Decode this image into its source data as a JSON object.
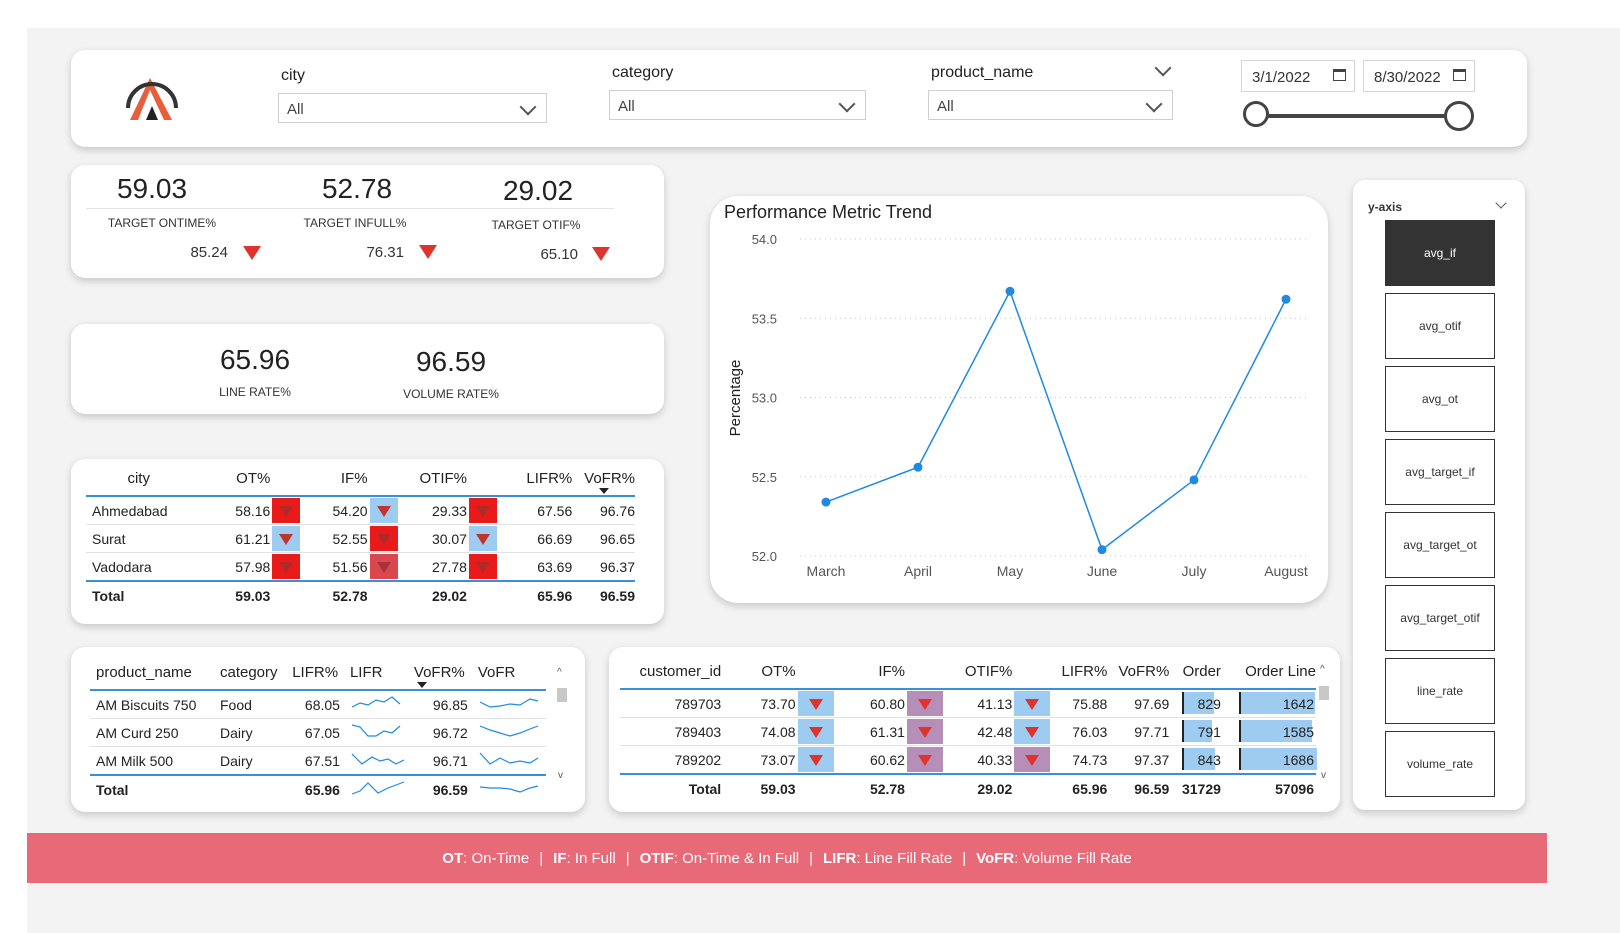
{
  "filters": {
    "city": {
      "label": "city",
      "value": "All"
    },
    "category": {
      "label": "category",
      "value": "All"
    },
    "product_name": {
      "label": "product_name",
      "value": "All"
    },
    "date_start": "3/1/2022",
    "date_end": "8/30/2022"
  },
  "kpis_top": [
    {
      "value": "59.03",
      "label": "TARGET ONTIME%",
      "target": "85.24"
    },
    {
      "value": "52.78",
      "label": "TARGET INFULL%",
      "target": "76.31"
    },
    {
      "value": "29.02",
      "label": "TARGET OTIF%",
      "target": "65.10"
    }
  ],
  "kpis_rates": [
    {
      "value": "65.96",
      "label": "LINE RATE%"
    },
    {
      "value": "96.59",
      "label": "VOLUME RATE%"
    }
  ],
  "city_table": {
    "headers": [
      "city",
      "OT%",
      "IF%",
      "OTIF%",
      "LIFR%",
      "VoFR%"
    ],
    "rows": [
      {
        "city": "Ahmedabad",
        "ot": "58.16",
        "if": "54.20",
        "otif": "29.33",
        "lifr": "67.56",
        "vofr": "96.76"
      },
      {
        "city": "Surat",
        "ot": "61.21",
        "if": "52.55",
        "otif": "30.07",
        "lifr": "66.69",
        "vofr": "96.65"
      },
      {
        "city": "Vadodara",
        "ot": "57.98",
        "if": "51.56",
        "otif": "27.78",
        "lifr": "63.69",
        "vofr": "96.37"
      }
    ],
    "total": {
      "label": "Total",
      "ot": "59.03",
      "if": "52.78",
      "otif": "29.02",
      "lifr": "65.96",
      "vofr": "96.59"
    }
  },
  "product_table": {
    "headers": [
      "product_name",
      "category",
      "LIFR%",
      "LIFR",
      "VoFR%",
      "VoFR"
    ],
    "rows": [
      {
        "name": "AM Biscuits 750",
        "category": "Food",
        "lifr": "68.05",
        "vofr": "96.85"
      },
      {
        "name": "AM Curd 250",
        "category": "Dairy",
        "lifr": "67.05",
        "vofr": "96.72"
      },
      {
        "name": "AM Milk 500",
        "category": "Dairy",
        "lifr": "67.51",
        "vofr": "96.71"
      }
    ],
    "total": {
      "label": "Total",
      "lifr": "65.96",
      "vofr": "96.59"
    }
  },
  "customer_table": {
    "headers": [
      "customer_id",
      "OT%",
      "IF%",
      "OTIF%",
      "LIFR%",
      "VoFR%",
      "Order",
      "Order Line"
    ],
    "rows": [
      {
        "id": "789703",
        "ot": "73.70",
        "if": "60.80",
        "otif": "41.13",
        "lifr": "75.88",
        "vofr": "97.69",
        "order": "829",
        "order_line": "1642"
      },
      {
        "id": "789403",
        "ot": "74.08",
        "if": "61.31",
        "otif": "42.48",
        "lifr": "76.03",
        "vofr": "97.71",
        "order": "791",
        "order_line": "1585"
      },
      {
        "id": "789202",
        "ot": "73.07",
        "if": "60.62",
        "otif": "40.33",
        "lifr": "74.73",
        "vofr": "97.37",
        "order": "843",
        "order_line": "1686"
      }
    ],
    "total": {
      "label": "Total",
      "ot": "59.03",
      "if": "52.78",
      "otif": "29.02",
      "lifr": "65.96",
      "vofr": "96.59",
      "order": "31729",
      "order_line": "57096"
    }
  },
  "chart_data": {
    "type": "line",
    "title": "Performance Metric Trend",
    "xlabel": "",
    "ylabel": "Percentage",
    "categories": [
      "March",
      "April",
      "May",
      "June",
      "July",
      "August"
    ],
    "series": [
      {
        "values": [
          52.34,
          52.56,
          53.67,
          52.04,
          52.48,
          53.62
        ]
      }
    ],
    "ylim": [
      52.0,
      54.0
    ],
    "yticks": [
      "52.0",
      "52.5",
      "53.0",
      "53.5",
      "54.0"
    ],
    "grid": true,
    "color": "#1f8ae0"
  },
  "yaxis_selector": {
    "label": "y-axis",
    "options": [
      "avg_if",
      "avg_otif",
      "avg_ot",
      "avg_target_if",
      "avg_target_ot",
      "avg_target_otif",
      "line_rate",
      "volume_rate"
    ],
    "selected": "avg_if"
  },
  "footer": [
    {
      "key": "OT",
      "desc": ": On-Time"
    },
    {
      "key": "IF",
      "desc": ": In Full"
    },
    {
      "key": "OTIF",
      "desc": ": On-Time & In Full"
    },
    {
      "key": "LIFR",
      "desc": ": Line Fill Rate"
    },
    {
      "key": "VoFR",
      "desc": ": Volume Fill Rate"
    }
  ],
  "colors": {
    "accent": "#1f8ae0",
    "bad": "#e0332d",
    "flag_blue": "#9ecbf0",
    "flag_purple": "#b58fb8",
    "footer": "#e86a78"
  }
}
